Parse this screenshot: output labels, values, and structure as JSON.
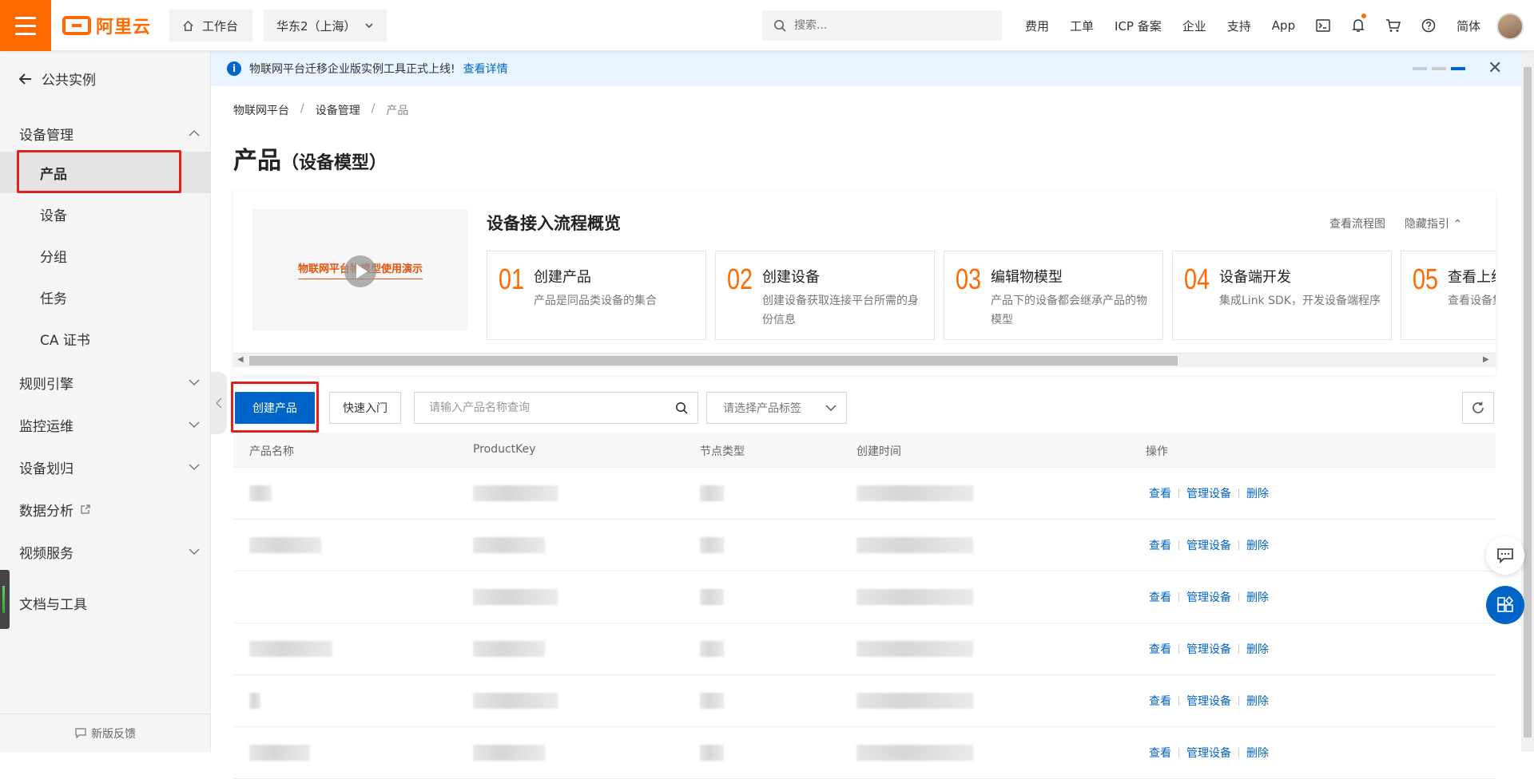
{
  "header": {
    "logo_text": "阿里云",
    "workbench": "工作台",
    "region": "华东2（上海）",
    "search_placeholder": "搜索...",
    "links": [
      "费用",
      "工单",
      "ICP 备案",
      "企业",
      "支持",
      "App"
    ],
    "lang": "简体"
  },
  "sidebar": {
    "back_label": "公共实例",
    "groups": {
      "device_mgmt": "设备管理",
      "rules": "规则引擎",
      "monitor": "监控运维",
      "assign": "设备划归",
      "analytics": "数据分析",
      "video": "视频服务",
      "docs": "文档与工具"
    },
    "items": [
      "产品",
      "设备",
      "分组",
      "任务",
      "CA 证书"
    ],
    "feedback": "新版反馈"
  },
  "notice": {
    "text": "物联网平台迁移企业版实例工具正式上线!",
    "link": "查看详情"
  },
  "breadcrumb": [
    "物联网平台",
    "设备管理",
    "产品"
  ],
  "page": {
    "title": "产品",
    "subtitle": "（设备模型）"
  },
  "guide": {
    "video_title": "物联网平台物模型使用演示",
    "title": "设备接入流程概览",
    "view_flow": "查看流程图",
    "hide_guide": "隐藏指引",
    "steps": [
      {
        "num": "01",
        "title": "创建产品",
        "desc": "产品是同品类设备的集合"
      },
      {
        "num": "02",
        "title": "创建设备",
        "desc": "创建设备获取连接平台所需的身份信息"
      },
      {
        "num": "03",
        "title": "编辑物模型",
        "desc": "产品下的设备都会继承产品的物模型"
      },
      {
        "num": "04",
        "title": "设备端开发",
        "desc": "集成Link SDK，开发设备端程序"
      },
      {
        "num": "05",
        "title": "查看上线",
        "desc": "查看设备集成Link SDK，开发"
      }
    ]
  },
  "toolbar": {
    "create": "创建产品",
    "quick_start": "快速入门",
    "search_placeholder": "请输入产品名称查询",
    "tag_placeholder": "请选择产品标签"
  },
  "table": {
    "columns": [
      "产品名称",
      "ProductKey",
      "节点类型",
      "创建时间",
      "操作"
    ],
    "row_count": 6,
    "actions": [
      "查看",
      "管理设备",
      "删除"
    ]
  },
  "colors": {
    "brand_orange": "#ff6a00",
    "primary_blue": "#0064c8",
    "highlight_red": "#e0201c"
  }
}
